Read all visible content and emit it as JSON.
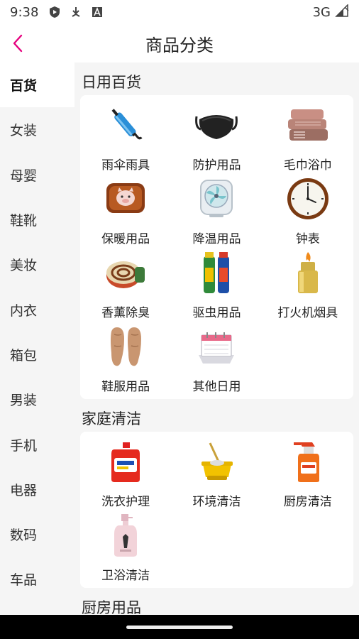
{
  "status": {
    "time": "9:38",
    "network": "3G"
  },
  "header": {
    "title": "商品分类"
  },
  "sidebar": {
    "items": [
      {
        "label": "百货"
      },
      {
        "label": "女装"
      },
      {
        "label": "母婴"
      },
      {
        "label": "鞋靴"
      },
      {
        "label": "美妆"
      },
      {
        "label": "内衣"
      },
      {
        "label": "箱包"
      },
      {
        "label": "男装"
      },
      {
        "label": "手机"
      },
      {
        "label": "电器"
      },
      {
        "label": "数码"
      },
      {
        "label": "车品"
      }
    ]
  },
  "sections": [
    {
      "title": "日用百货",
      "items": [
        {
          "label": "雨伞雨具",
          "icon": "umbrella-icon"
        },
        {
          "label": "防护用品",
          "icon": "face-mask-icon"
        },
        {
          "label": "毛巾浴巾",
          "icon": "towel-icon"
        },
        {
          "label": "保暖用品",
          "icon": "hot-water-bag-icon"
        },
        {
          "label": "降温用品",
          "icon": "fan-icon"
        },
        {
          "label": "钟表",
          "icon": "clock-icon"
        },
        {
          "label": "香薰除臭",
          "icon": "mosquito-coil-icon"
        },
        {
          "label": "驱虫用品",
          "icon": "insect-spray-icon"
        },
        {
          "label": "打火机烟具",
          "icon": "lighter-icon"
        },
        {
          "label": "鞋服用品",
          "icon": "insole-icon"
        },
        {
          "label": "其他日用",
          "icon": "calendar-icon"
        }
      ]
    },
    {
      "title": "家庭清洁",
      "items": [
        {
          "label": "洗衣护理",
          "icon": "detergent-icon"
        },
        {
          "label": "环境清洁",
          "icon": "mop-bucket-icon"
        },
        {
          "label": "厨房清洁",
          "icon": "spray-bottle-icon"
        },
        {
          "label": "卫浴清洁",
          "icon": "body-wash-icon"
        }
      ]
    },
    {
      "title": "厨房用品",
      "items": []
    }
  ],
  "colors": {
    "accent": "#e6007e",
    "background": "#f5f5f5"
  }
}
